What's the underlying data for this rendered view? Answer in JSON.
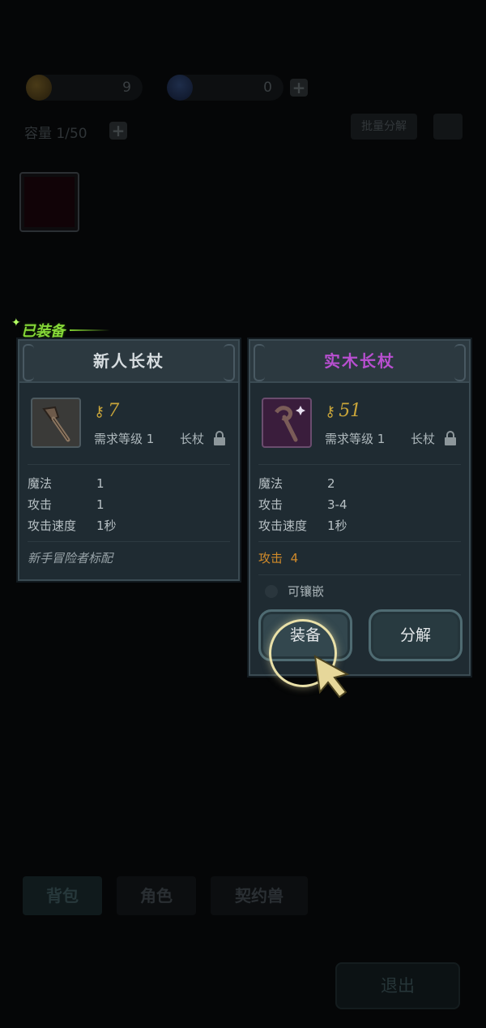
{
  "resources": {
    "gold": "9",
    "gems": "0"
  },
  "inventory": {
    "capacity": "容量 1/50",
    "batch_decompose": "批量分解"
  },
  "equipped_tag": "已装备",
  "card_left": {
    "name": "新人长杖",
    "power": "7",
    "req": "需求等级 1",
    "weapon_type": "长杖",
    "stats": [
      {
        "k": "魔法",
        "v": "1"
      },
      {
        "k": "攻击",
        "v": "1"
      },
      {
        "k": "攻击速度",
        "v": "1秒"
      }
    ],
    "flavor": "新手冒险者标配",
    "name_color": "#d7dde0"
  },
  "card_right": {
    "name": "实木长杖",
    "power": "51",
    "req": "需求等级 1",
    "weapon_type": "长杖",
    "stats": [
      {
        "k": "魔法",
        "v": "2"
      },
      {
        "k": "攻击",
        "v": "3-4"
      },
      {
        "k": "攻击速度",
        "v": "1秒"
      }
    ],
    "bonus_key": "攻击",
    "bonus_val": "4",
    "socket": "可镶嵌",
    "equip_button": "装备",
    "decompose_button": "分解",
    "name_color": "#b84fd0",
    "bonus_color": "#d08a2a"
  },
  "bottom_tabs": {
    "bag": "背包",
    "role": "角色",
    "contract": "契约兽"
  },
  "exit_button": "退出",
  "icons": {
    "power": "key-icon",
    "lock": "lock-icon",
    "gold": "gold-coin-icon",
    "gem": "crystal-icon"
  }
}
